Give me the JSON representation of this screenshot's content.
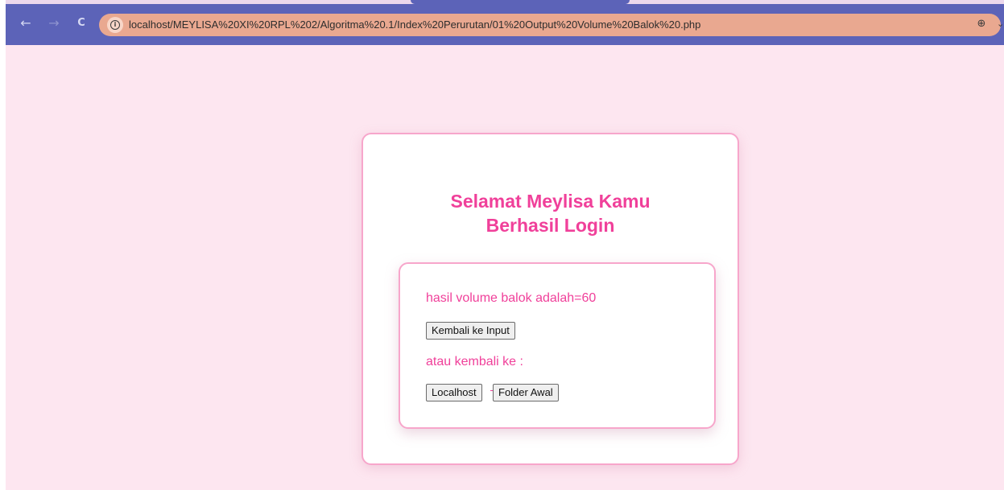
{
  "browser": {
    "back_icon": "←",
    "forward_icon": "→",
    "reload_icon": "C",
    "site_info_icon": "i",
    "url": "localhost/MEYLISA%20XI%20RPL%202/Algoritma%20.1/Index%20Perurutan/01%20Output%20Volume%20Balok%20.php",
    "zoom_icon": "⊕",
    "chevron_icon": "⌄"
  },
  "page": {
    "title": "Selamat Meylisa Kamu Berhasil Login",
    "result_text": "hasil volume balok adalah=60",
    "back_button": "Kembali ke Input",
    "or_text": "atau kembali ke :",
    "localhost_button": "Localhost",
    "folder_button": "Folder Awal"
  },
  "colors": {
    "accent": "#f0409a",
    "page_background": "#fde6f0",
    "card_border": "#f7a6cb",
    "browser_chrome": "#5c63b8",
    "omnibox": "#e9a890"
  }
}
